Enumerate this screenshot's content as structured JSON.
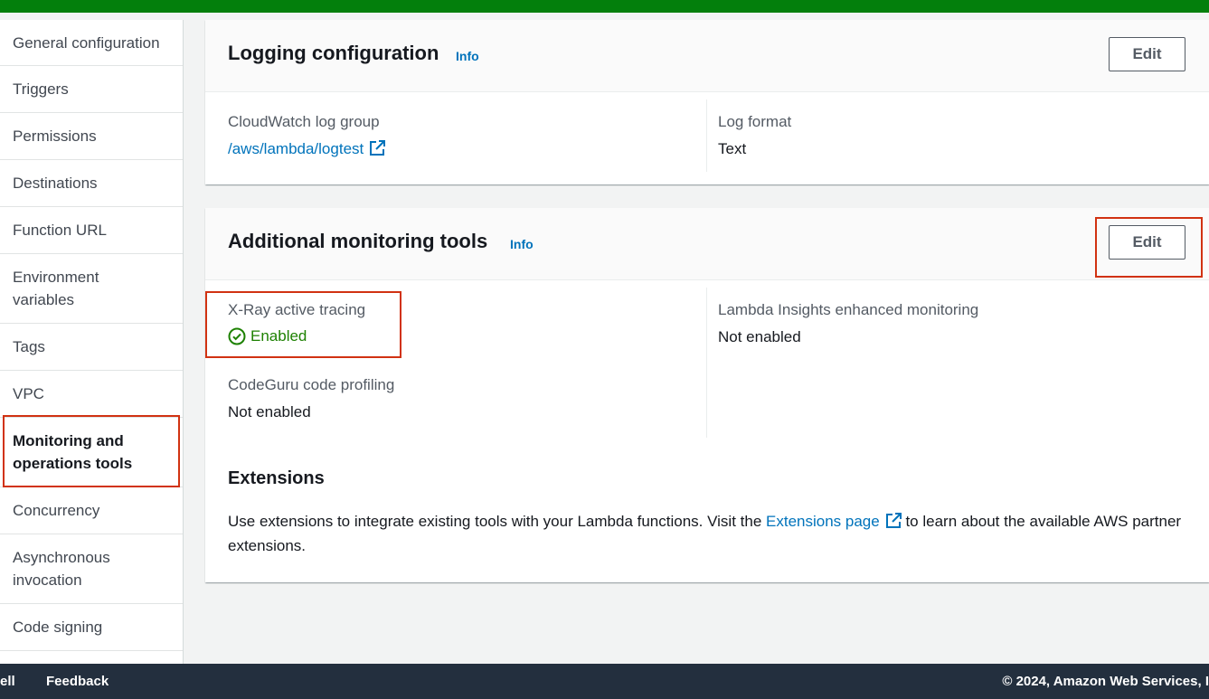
{
  "sidebar": {
    "items": [
      {
        "label": "General configuration"
      },
      {
        "label": "Triggers"
      },
      {
        "label": "Permissions"
      },
      {
        "label": "Destinations"
      },
      {
        "label": "Function URL"
      },
      {
        "label": "Environment variables"
      },
      {
        "label": "Tags"
      },
      {
        "label": "VPC"
      },
      {
        "label": "Monitoring and operations tools"
      },
      {
        "label": "Concurrency"
      },
      {
        "label": "Asynchronous invocation"
      },
      {
        "label": "Code signing"
      }
    ],
    "active_item": "Monitoring and operations tools"
  },
  "logging": {
    "title": "Logging configuration",
    "info": "Info",
    "edit_label": "Edit",
    "log_group_label": "CloudWatch log group",
    "log_group_value": "/aws/lambda/logtest",
    "log_format_label": "Log format",
    "log_format_value": "Text"
  },
  "monitoring": {
    "title": "Additional monitoring tools",
    "info": "Info",
    "edit_label": "Edit",
    "xray_label": "X-Ray active tracing",
    "xray_value": "Enabled",
    "insights_label": "Lambda Insights enhanced monitoring",
    "insights_value": "Not enabled",
    "codeguru_label": "CodeGuru code profiling",
    "codeguru_value": "Not enabled",
    "extensions_title": "Extensions",
    "extensions_text_before": "Use extensions to integrate existing tools with your Lambda functions. Visit the ",
    "extensions_link": "Extensions page",
    "extensions_text_after": " to learn about the available AWS partner extensions."
  },
  "footer": {
    "left_partial": "ell",
    "feedback": "Feedback",
    "copyright": "© 2024, Amazon Web Services, I"
  },
  "colors": {
    "top_bar": "#037f0c",
    "highlight": "#d13212",
    "link": "#0073bb",
    "success": "#1d8102",
    "footer_bg": "#232f3e"
  },
  "icons": [
    "external-link-icon",
    "check-circle-icon"
  ]
}
